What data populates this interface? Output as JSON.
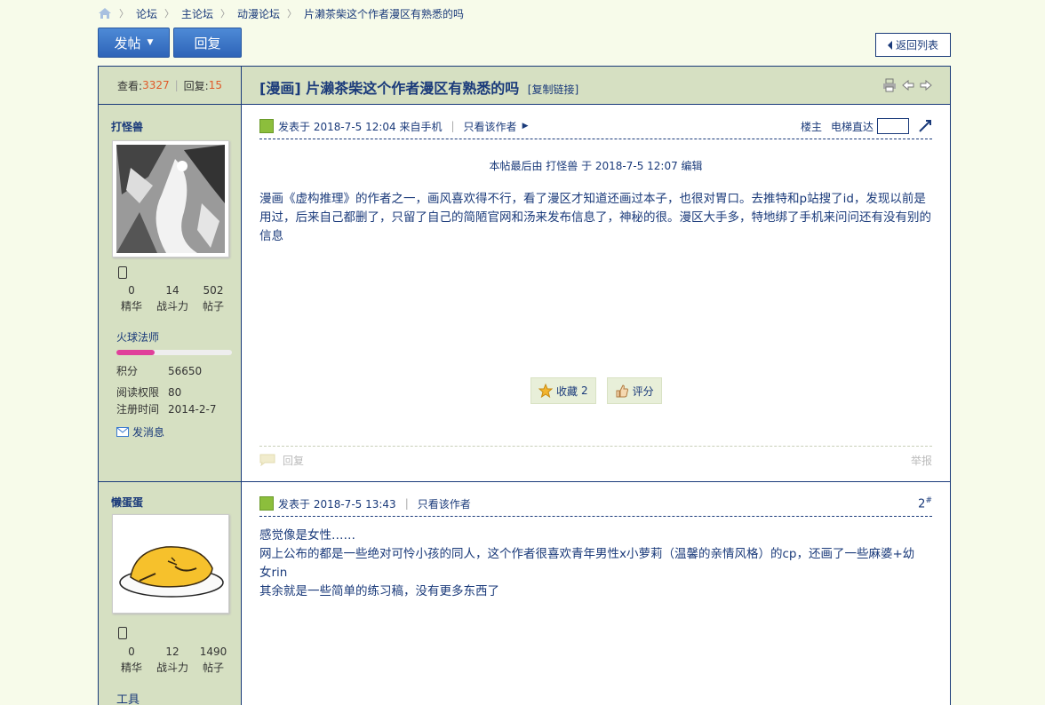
{
  "breadcrumb": [
    "论坛",
    "主论坛",
    "动漫论坛",
    "片濑茶柴这个作者漫区有熟悉的吗"
  ],
  "buttons": {
    "post": "发帖",
    "reply": "回复",
    "back": "返回列表"
  },
  "thread": {
    "views_label": "查看:",
    "views": "3327",
    "replies_label": "回复:",
    "replies": "15",
    "title": "[漫画] 片濑茶柴这个作者漫区有熟悉的吗",
    "copy_link": "[复制链接]"
  },
  "posts": [
    {
      "author": "打怪兽",
      "stats": [
        {
          "value": "0",
          "label": "精华"
        },
        {
          "value": "14",
          "label": "战斗力"
        },
        {
          "value": "502",
          "label": "帖子"
        }
      ],
      "rank": "火球法师",
      "rank_progress": 0.33,
      "kv": [
        {
          "k": "积分",
          "v": "56650"
        },
        {
          "k": "阅读权限",
          "v": "80"
        },
        {
          "k": "注册时间",
          "v": "2014-2-7"
        }
      ],
      "send_msg": "发消息",
      "meta": "发表于 2018-7-5 12:04 来自手机",
      "only_author": "只看该作者",
      "floor_label": "楼主",
      "jump_label": "电梯直达",
      "edited": "本帖最后由 打怪兽 于 2018-7-5 12:07 编辑",
      "body": "漫画《虚构推理》的作者之一，画风喜欢得不行，看了漫区才知道还画过本子，也很对胃口。去推特和p站搜了id，发现以前是用过，后来自己都删了，只留了自己的简陋官网和汤来发布信息了，神秘的很。漫区大手多，特地绑了手机来问问还有没有别的信息",
      "fav": "收藏",
      "fav_count": "2",
      "rate": "评分",
      "reply": "回复",
      "report": "举报"
    },
    {
      "author": "懒蛋蛋",
      "stats": [
        {
          "value": "0",
          "label": "精华"
        },
        {
          "value": "12",
          "label": "战斗力"
        },
        {
          "value": "1490",
          "label": "帖子"
        }
      ],
      "rank": "工具",
      "meta": "发表于 2018-7-5 13:43",
      "only_author": "只看该作者",
      "floor": "2",
      "floor_sup": "#",
      "body_lines": [
        "感觉像是女性……",
        "网上公布的都是一些绝对可怜小孩的同人，这个作者很喜欢青年男性x小萝莉（温馨的亲情风格）的cp，还画了一些麻婆+幼女rin",
        "其余就是一些简单的练习稿，没有更多东西了"
      ]
    }
  ]
}
